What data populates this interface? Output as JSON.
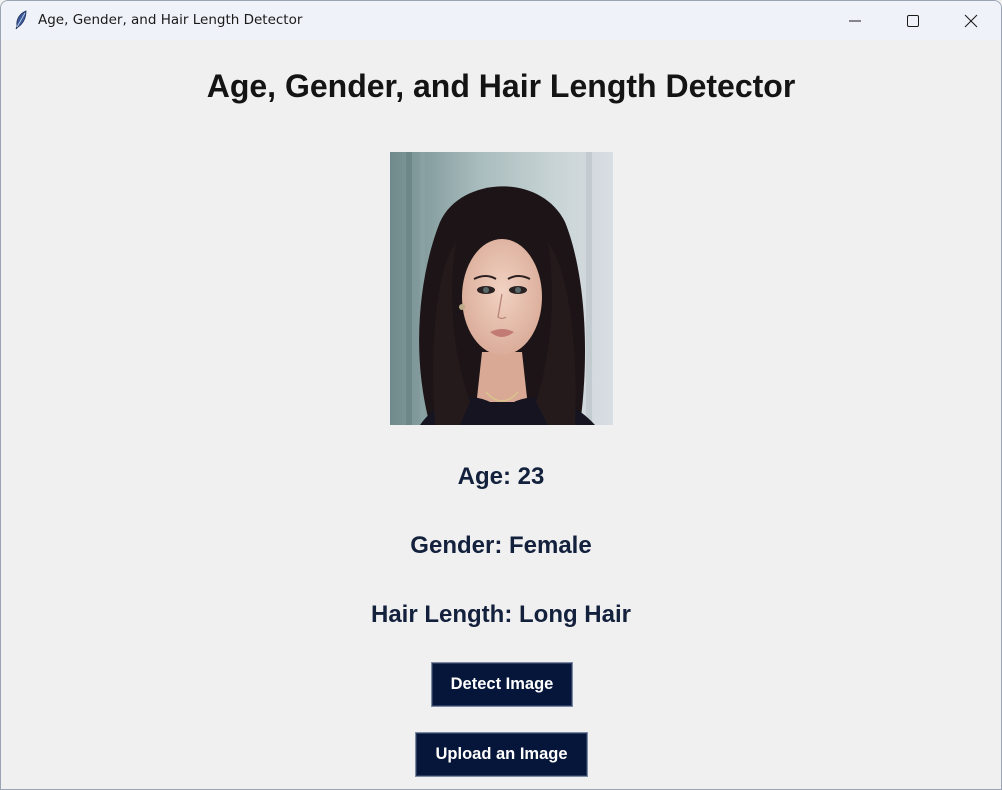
{
  "window": {
    "title": "Age, Gender, and Hair Length Detector",
    "icon": "feather-icon",
    "controls": [
      "minimize-icon",
      "maximize-icon",
      "close-icon"
    ]
  },
  "main": {
    "heading": "Age, Gender, and Hair Length Detector",
    "image": {
      "subject": "portrait-photo"
    },
    "results": {
      "age": "Age: 23",
      "gender": "Gender: Female",
      "hair_length": "Hair Length: Long Hair"
    },
    "buttons": {
      "detect_label": "Detect Image",
      "upload_label": "Upload an Image"
    }
  },
  "colors": {
    "background": "#f0f0f0",
    "titlebar": "#eff3f9",
    "button_bg": "#06163a",
    "button_text": "#ffffff",
    "result_text": "#13213d"
  }
}
